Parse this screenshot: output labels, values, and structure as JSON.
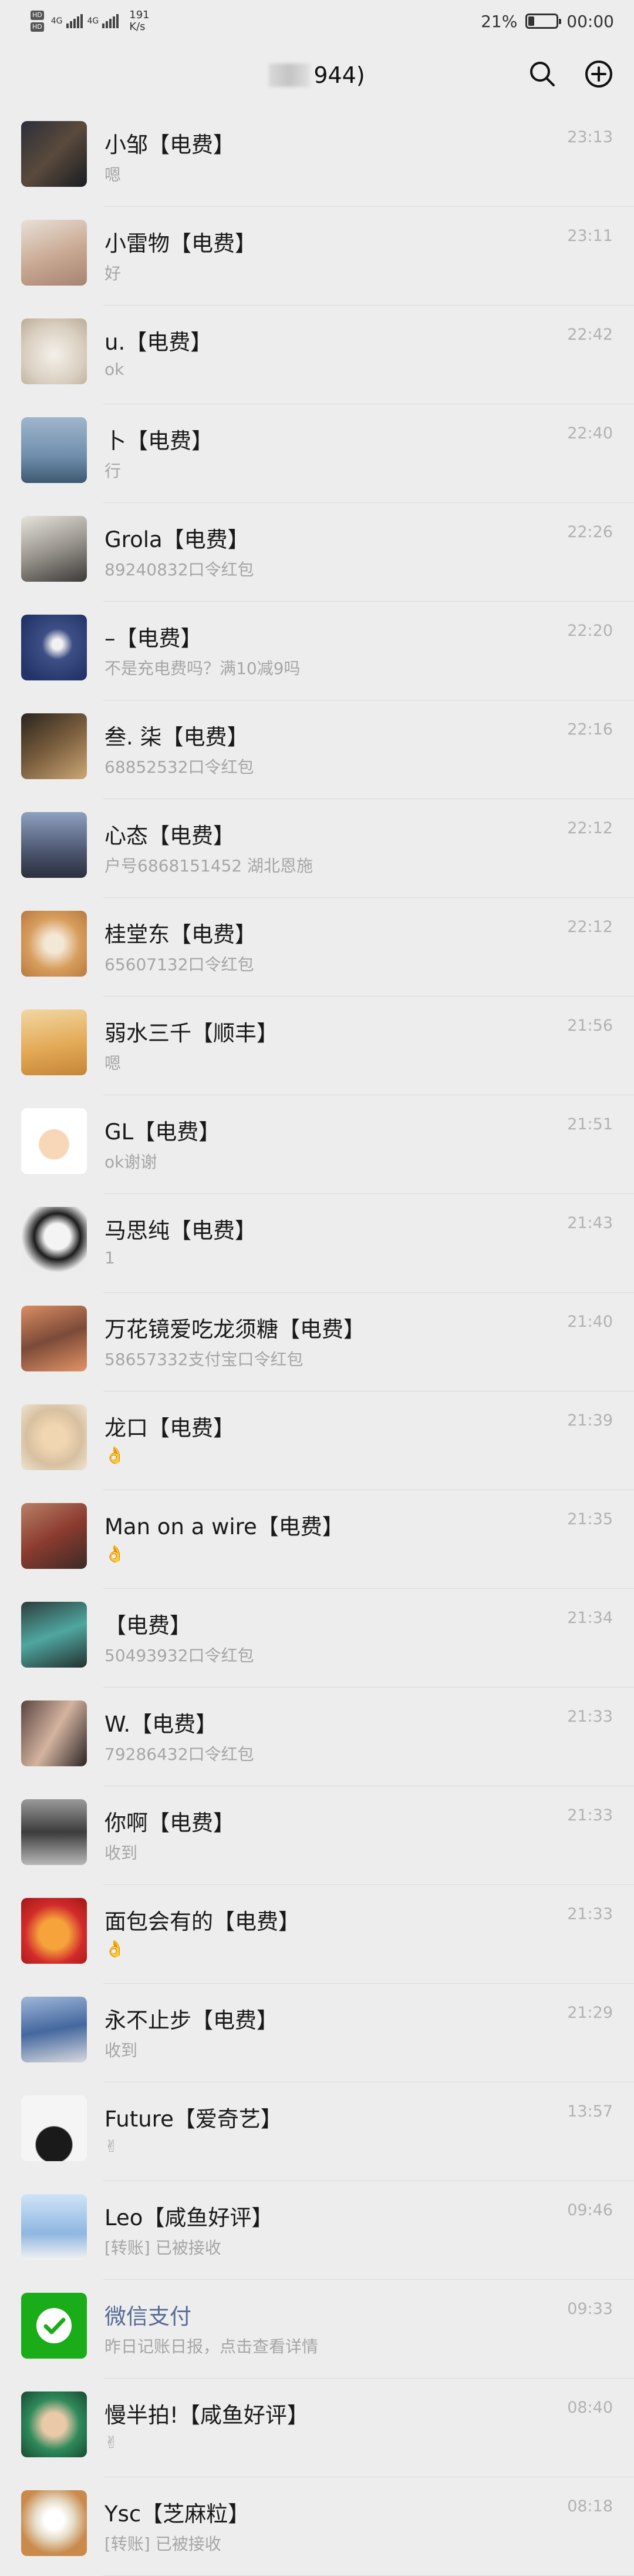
{
  "status_bar": {
    "net1": "HD",
    "net2": "HD",
    "sig1": "4G",
    "sig2": "4G",
    "speed_value": "191",
    "speed_unit": "K/s",
    "battery_percent": "21%",
    "battery_level": 0.21,
    "time": "00:00"
  },
  "header": {
    "title_suffix": "944)"
  },
  "chats": [
    {
      "name": "小邹【电费】",
      "msg": "嗯",
      "time": "23:13",
      "bg": "linear-gradient(135deg,#2b2f3a,#5a4a3c 50%,#1a1c22)"
    },
    {
      "name": "小雷物【电费】",
      "msg": "好",
      "time": "23:11",
      "bg": "linear-gradient(160deg,#e9e0d7,#c9a893 55%,#a58470)"
    },
    {
      "name": "u.【电费】",
      "msg": "ok",
      "time": "22:42",
      "bg": "radial-gradient(circle at 50% 55%,#f4f0ea,#d9cfc0 60%,#b9ab96)"
    },
    {
      "name": "卜【电费】",
      "msg": "行",
      "time": "22:40",
      "bg": "linear-gradient(180deg,#9fb6cc,#6f8eab 60%,#3d5871)"
    },
    {
      "name": "Grola【电费】",
      "msg": "89240832口令红包",
      "time": "22:26",
      "bg": "linear-gradient(160deg,#e6e3dd,#9a968f 50%,#3b3a37)"
    },
    {
      "name": "–【电费】",
      "msg": "不是充电费吗？满10减9吗",
      "time": "22:20",
      "bg": "radial-gradient(circle at 55% 45%,#f1f1f1 10%,#3d4f86 30%,#233468 80%)"
    },
    {
      "name": "叁. 柒【电费】",
      "msg": "68852532口令红包",
      "time": "22:16",
      "bg": "linear-gradient(145deg,#2a241e,#7a5e3e 50%,#caa775)"
    },
    {
      "name": "心态【电费】",
      "msg": "户号6868151452  湖北恩施",
      "time": "22:12",
      "bg": "linear-gradient(180deg,#8ea0c0,#4d5670 60%,#2a2f3d)"
    },
    {
      "name": "桂堂东【电费】",
      "msg": "65607132口令红包",
      "time": "22:12",
      "bg": "radial-gradient(circle at 50% 50%,#f3e7d5 20%,#d89e5e 55%,#b77a3f)"
    },
    {
      "name": "弱水三千【顺丰】",
      "msg": "嗯",
      "time": "21:56",
      "bg": "linear-gradient(170deg,#f2d7a2,#e3aa57 55%,#c58537)"
    },
    {
      "name": "GL【电费】",
      "msg": "ok谢谢",
      "time": "21:51",
      "bg": "radial-gradient(circle at 50% 55%,#f8d6b8 30%,#ffffff 32%)"
    },
    {
      "name": "马思纯【电费】",
      "msg": "1",
      "time": "21:43",
      "bg": "radial-gradient(circle at 55% 45%,#f4f4f4 25%,#1c1c1c 45%,#ececec 70%)"
    },
    {
      "name": "万花镜爱吃龙须糖【电费】",
      "msg": "58657332支付宝口令红包",
      "time": "21:40",
      "bg": "linear-gradient(160deg,#d98d63,#7c4a38 50%,#e29468)"
    },
    {
      "name": "龙口【电费】",
      "msg": "👌",
      "time": "21:39",
      "bg": "radial-gradient(circle at 50% 50%,#f1d6b2 25%,#d7c0a0 60%,#efe4d3)"
    },
    {
      "name": "Man on a wire【电费】",
      "msg": "👌",
      "time": "21:35",
      "bg": "linear-gradient(150deg,#b88067,#8b3b2f 50%,#3d2a26)"
    },
    {
      "name": "【电费】",
      "msg": "50493932口令红包",
      "time": "21:34",
      "bg": "linear-gradient(160deg,#2e3d3c,#4fa7a0 50%,#233130)"
    },
    {
      "name": "W.【电费】",
      "msg": "79286432口令红包",
      "time": "21:33",
      "bg": "linear-gradient(120deg,#5a4440,#d4b4a0 50%,#2c2424)"
    },
    {
      "name": "你啊【电费】",
      "msg": "收到",
      "time": "21:33",
      "bg": "linear-gradient(180deg,#9a9a9a,#3c3c3c 50%,#b8b8b8)"
    },
    {
      "name": "面包会有的【电费】",
      "msg": "👌",
      "time": "21:33",
      "bg": "radial-gradient(circle at 50% 55%,#f6a33c 30%,#d12b2b 60%,#a31616)"
    },
    {
      "name": "永不止步【电费】",
      "msg": "收到",
      "time": "21:29",
      "bg": "linear-gradient(170deg,#9fb7d9,#44679e 50%,#d7d9de)"
    },
    {
      "name": "Future【爱奇艺】",
      "msg": "✌",
      "time": "13:57",
      "bg": "radial-gradient(circle at 50% 75%,#1a1a1a 30%,#f5f5f5 32%)"
    },
    {
      "name": "Leo【咸鱼好评】",
      "msg": "[转账] 已被接收",
      "time": "09:46",
      "bg": "linear-gradient(180deg,#cfe3f7,#8fb7e1 60%,#f2f2f2)"
    },
    {
      "name": "微信支付",
      "msg": "昨日记账日报，点击查看详情",
      "time": "09:33",
      "bg": "#1aad19",
      "official": true
    },
    {
      "name": "慢半拍!【咸鱼好评】",
      "msg": "✌",
      "time": "08:40",
      "bg": "radial-gradient(circle at 50% 50%,#e9c9a8 25%,#2f8a5a 55%,#174a32)"
    },
    {
      "name": "Ysc【芝麻粒】",
      "msg": "[转账] 已被接收",
      "time": "08:18",
      "bg": "radial-gradient(circle at 50% 45%,#ffffff 20%,#e6dcc8 40%,#c98a4c 70%)"
    }
  ]
}
